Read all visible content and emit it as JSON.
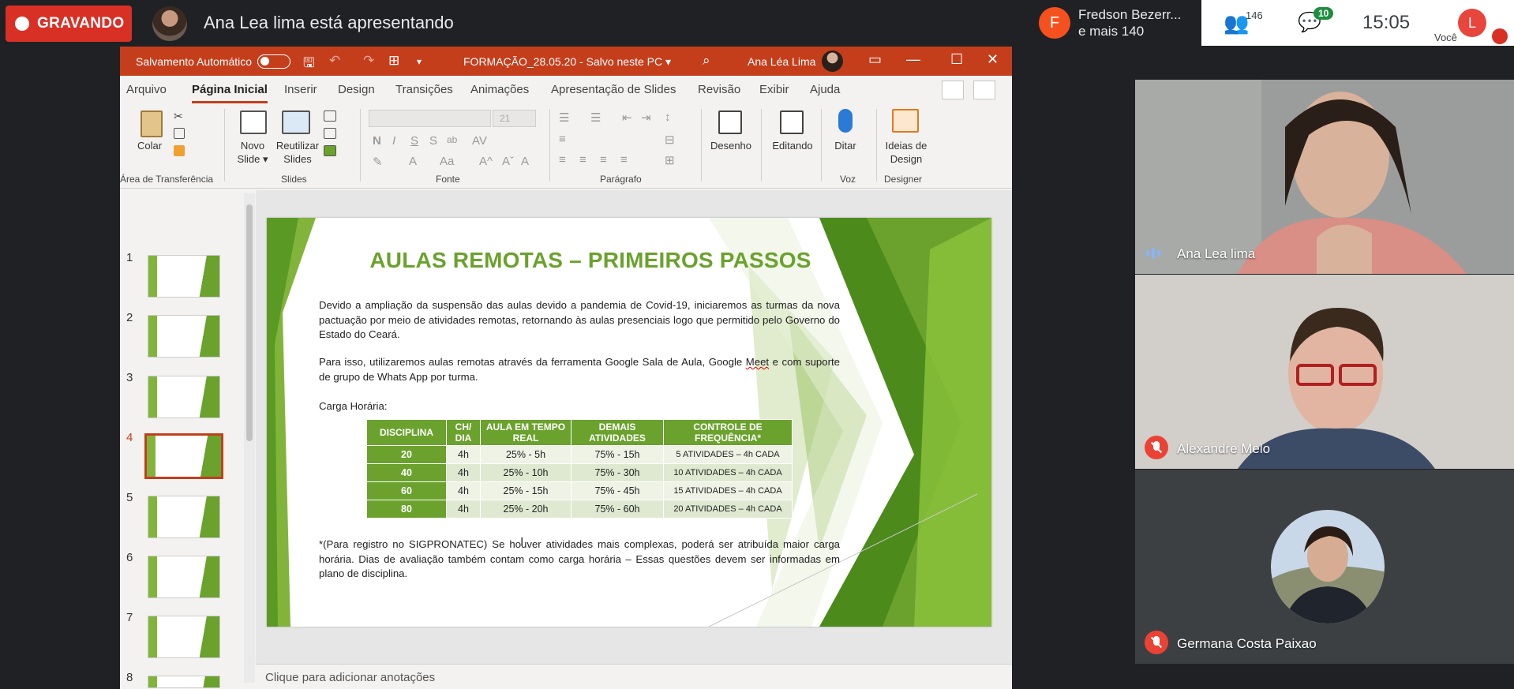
{
  "meet": {
    "recording_label": "GRAVANDO",
    "presenter_text": "Ana Lea lima está apresentando",
    "participant_chip": {
      "avatar_letter": "F",
      "line1": "Fredson Bezerr...",
      "line2": "e mais 140"
    },
    "people_count": "146",
    "chat_count": "10",
    "time": "15:05",
    "me": {
      "avatar_letter": "L",
      "label": "Você"
    },
    "tiles": [
      {
        "name": "Ana Lea lima",
        "status": "speaking"
      },
      {
        "name": "Alexandre Melo",
        "status": "muted"
      },
      {
        "name": "Germana Costa Paixao",
        "status": "muted"
      }
    ]
  },
  "ppt": {
    "autosave_label": "Salvamento Automático",
    "file_title": "FORMAÇÃO_28.05.20  -  Salvo neste PC ▾",
    "user_name": "Ana Léa Lima",
    "tabs": [
      "Arquivo",
      "Página Inicial",
      "Inserir",
      "Design",
      "Transições",
      "Animações",
      "Apresentação de Slides",
      "Revisão",
      "Exibir",
      "Ajuda"
    ],
    "active_tab": "Página Inicial",
    "ribbon": {
      "paste": "Colar",
      "clipboard_group": "Área de Transferência",
      "new_slide": "Novo Slide ▾",
      "reuse_slides": "Reutilizar Slides",
      "slides_group": "Slides",
      "font_size": "21",
      "font_group": "Fonte",
      "paragraph_group": "Parágrafo",
      "drawing": "Desenho",
      "editing": "Editando",
      "dictate": "Ditar",
      "voice_group": "Voz",
      "design_ideas": "Ideias de Design",
      "designer_group": "Designer"
    },
    "thumbnails": [
      "1",
      "2",
      "3",
      "4",
      "5",
      "6",
      "7",
      "8"
    ],
    "active_slide": "4",
    "notes_placeholder": "Clique para adicionar anotações",
    "slide": {
      "title": "AULAS REMOTAS – PRIMEIROS PASSOS",
      "p1": "Devido a ampliação da suspensão das aulas devido a pandemia de Covid-19, iniciaremos as turmas da nova pactuação por meio de atividades remotas, retornando às aulas presenciais logo que permitido pelo Governo do Estado do Ceará.",
      "p2_before": "Para isso, utilizaremos aulas remotas através da ferramenta Google Sala de Aula, Google ",
      "p2_meet": "Meet",
      "p2_after": " e com suporte de grupo de Whats App por turma.",
      "carga": "Carga Horária:",
      "table": {
        "headers": [
          "DISCIPLINA",
          "CH/ DIA",
          "AULA EM TEMPO REAL",
          "DEMAIS ATIVIDADES",
          "CONTROLE DE FREQUÊNCIA*"
        ],
        "rows": [
          [
            "20",
            "4h",
            "25% - 5h",
            "75% - 15h",
            "5 ATIVIDADES – 4h CADA"
          ],
          [
            "40",
            "4h",
            "25% - 10h",
            "75% - 30h",
            "10 ATIVIDADES – 4h CADA"
          ],
          [
            "60",
            "4h",
            "25% - 15h",
            "75% - 45h",
            "15 ATIVIDADES – 4h CADA"
          ],
          [
            "80",
            "4h",
            "25% - 20h",
            "75% - 60h",
            "20 ATIVIDADES – 4h CADA"
          ]
        ]
      },
      "footnote": "*(Para registro no SIGPRONATEC) Se houver atividades mais complexas, poderá ser atribuída maior carga horária. Dias de avaliação também contam como carga horária – Essas questões devem ser informadas em plano de disciplina."
    }
  },
  "colors": {
    "ppt_accent": "#c43e1c",
    "slide_green": "#6aa22d",
    "recording_red": "#d93025",
    "meet_bg": "#202124"
  }
}
